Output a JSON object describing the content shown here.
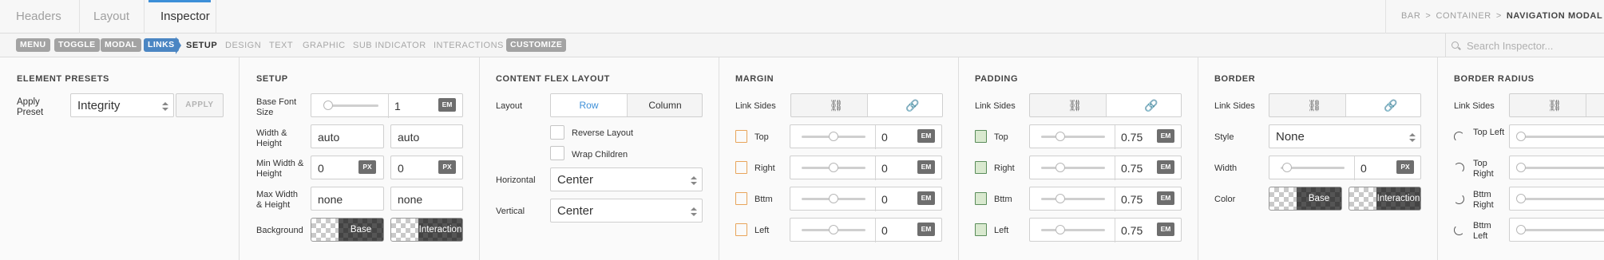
{
  "top_tabs": [
    {
      "label": "Headers"
    },
    {
      "label": "Layout"
    },
    {
      "label": "Inspector"
    }
  ],
  "breadcrumb": [
    "BAR",
    "CONTAINER",
    "NAVIGATION MODAL"
  ],
  "element_pills": [
    "MENU",
    "TOGGLE",
    "MODAL",
    "LINKS"
  ],
  "sub_tabs": [
    "SETUP",
    "DESIGN",
    "TEXT",
    "GRAPHIC",
    "SUB INDICATOR",
    "INTERACTIONS"
  ],
  "customize_label": "CUSTOMIZE",
  "search": {
    "placeholder": "Search Inspector..."
  },
  "element_presets": {
    "title": "ELEMENT PRESETS",
    "apply_label": "Apply Preset",
    "preset_value": "Integrity",
    "apply_button": "APPLY"
  },
  "setup": {
    "title": "SETUP",
    "base_font_label": "Base Font Size",
    "base_font_value": "1",
    "base_font_unit": "EM",
    "base_font_level": 0.05,
    "wh_label": "Width & Height",
    "width": "auto",
    "height": "auto",
    "min_label": "Min Width & Height",
    "min_width": "0",
    "min_height": "0",
    "min_unit": "PX",
    "max_label": "Max Width & Height",
    "max_width": "none",
    "max_height": "none",
    "bg_label": "Background",
    "base_label": "Base",
    "interaction_label": "Interaction"
  },
  "flex": {
    "title": "CONTENT FLEX LAYOUT",
    "layout_label": "Layout",
    "row": "Row",
    "column": "Column",
    "reverse": "Reverse Layout",
    "wrap": "Wrap Children",
    "horizontal_label": "Horizontal",
    "horizontal_value": "Center",
    "vertical_label": "Vertical",
    "vertical_value": "Center"
  },
  "margin": {
    "title": "MARGIN",
    "link_label": "Link Sides",
    "sides": [
      {
        "label": "Top",
        "value": "0",
        "unit": "EM",
        "level": 0.5
      },
      {
        "label": "Right",
        "value": "0",
        "unit": "EM",
        "level": 0.5
      },
      {
        "label": "Bttm",
        "value": "0",
        "unit": "EM",
        "level": 0.5
      },
      {
        "label": "Left",
        "value": "0",
        "unit": "EM",
        "level": 0.5
      }
    ]
  },
  "padding": {
    "title": "PADDING",
    "link_label": "Link Sides",
    "sides": [
      {
        "label": "Top",
        "value": "0.75",
        "unit": "EM",
        "level": 0.3
      },
      {
        "label": "Right",
        "value": "0.75",
        "unit": "EM",
        "level": 0.3
      },
      {
        "label": "Bttm",
        "value": "0.75",
        "unit": "EM",
        "level": 0.3
      },
      {
        "label": "Left",
        "value": "0.75",
        "unit": "EM",
        "level": 0.3
      }
    ]
  },
  "border": {
    "title": "BORDER",
    "link_label": "Link Sides",
    "style_label": "Style",
    "style_value": "None",
    "width_label": "Width",
    "width_value": "0",
    "width_unit": "PX",
    "width_level": 0.1,
    "color_label": "Color",
    "base_label": "Base",
    "interaction_label": "Interaction"
  },
  "border_radius": {
    "title": "BORDER RADIUS",
    "link_label": "Link Sides",
    "corners": [
      "Top Left",
      "Top Right",
      "Bttm Right",
      "Bttm Left"
    ]
  }
}
